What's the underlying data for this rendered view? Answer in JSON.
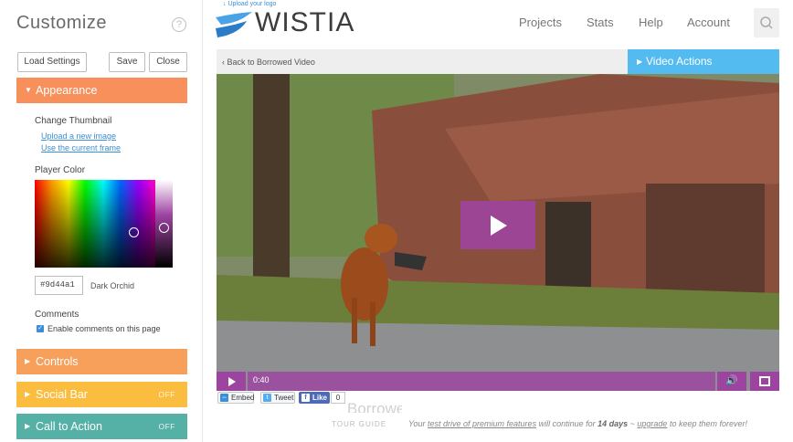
{
  "sidebar": {
    "title": "Customize",
    "help_icon": "?",
    "load_settings": "Load Settings",
    "save": "Save",
    "close": "Close",
    "appearance": {
      "label": "Appearance",
      "change_thumbnail": "Change Thumbnail",
      "upload_image": "Upload a new image",
      "use_frame": "Use the current frame",
      "player_color": "Player Color",
      "hex": "#9d44a1",
      "color_name": "Dark Orchid",
      "comments": "Comments",
      "enable_comments": "Enable comments on this page"
    },
    "controls": {
      "label": "Controls"
    },
    "social_bar": {
      "label": "Social Bar",
      "state": "OFF"
    },
    "call_to_action": {
      "label": "Call to Action",
      "state": "OFF"
    }
  },
  "header": {
    "upload_logo": "↓ Upload your logo",
    "logo": "WISTIA",
    "nav": [
      "Projects",
      "Stats",
      "Help",
      "Account"
    ]
  },
  "action_bar": {
    "back": "Back to Borrowed Video",
    "video_actions": "Video Actions"
  },
  "player": {
    "accent_color": "#9d44a1",
    "time": "0:40"
  },
  "social": {
    "embed": "Embed",
    "tweet": "Tweet",
    "like": "Like",
    "like_count": "0"
  },
  "video_title_partial": "Borrowed Video",
  "tour_guide": {
    "label": "TOUR GUIDE",
    "msg_pre": "Your ",
    "msg_link": "test drive of premium features",
    "msg_mid": " will continue for ",
    "msg_days": "14 days",
    "msg_sep": " ~ ",
    "msg_upgrade": "upgrade",
    "msg_post": " to keep them forever!"
  }
}
